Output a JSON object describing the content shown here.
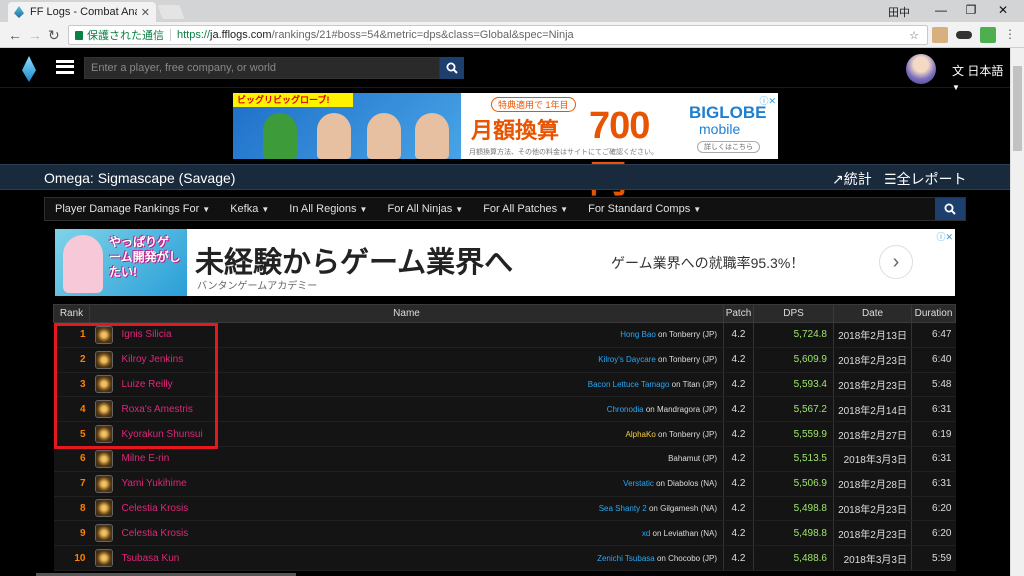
{
  "browser": {
    "tab_title": "FF Logs - Combat Analys",
    "user": "田中",
    "secure_label": "保護された通信",
    "url_scheme": "https://",
    "url_host": "ja.fflogs.com",
    "url_path": "/rankings/21#boss=54&metric=dps&class=Global&spec=Ninja"
  },
  "site": {
    "search_placeholder": "Enter a player, free company, or world",
    "language": "日本語"
  },
  "ad_top": {
    "ribbon": "ビッグリビッグローブ!",
    "tag": "特典適用で 1年目",
    "big_text": "月額換算",
    "price": "700円",
    "fine_print": "月額換算方法、その他の料金はサイトにてご確認ください。",
    "brand1": "BIGLOBE",
    "brand2": "mobile",
    "details": "詳しくはこちら"
  },
  "zone": {
    "title": "Omega: Sigmascape (Savage)",
    "stats": "統計",
    "all_reports": "全レポート"
  },
  "filters": [
    "Player Damage Rankings For",
    "Kefka",
    "In All Regions",
    "For All Ninjas",
    "For All Patches",
    "For Standard Comps"
  ],
  "ad_game": {
    "image_text": "やっぱりゲーム開発がしたい!",
    "headline": "未経験からゲーム業界へ",
    "sub": "バンタンゲームアカデミー",
    "side": "ゲーム業界への就職率95.3%！"
  },
  "table": {
    "headers": [
      "Rank",
      "Name",
      "Patch",
      "DPS",
      "Date",
      "Duration"
    ],
    "rows": [
      {
        "rank": "1",
        "name": "Ignis Silicia",
        "guild": "Hong Bao",
        "server": " on Tonberry (JP)",
        "patch": "4.2",
        "dps": "5,724.8",
        "date": "2018年2月13日",
        "dur": "6:47"
      },
      {
        "rank": "2",
        "name": "Kilroy Jenkins",
        "guild": "Kilroy's Daycare",
        "server": " on Tonberry (JP)",
        "patch": "4.2",
        "dps": "5,609.9",
        "date": "2018年2月23日",
        "dur": "6:40"
      },
      {
        "rank": "3",
        "name": "Luize Reilly",
        "guild": "Bacon Lettuce Tamago",
        "server": " on Titan (JP)",
        "patch": "4.2",
        "dps": "5,593.4",
        "date": "2018年2月23日",
        "dur": "5:48"
      },
      {
        "rank": "4",
        "name": "Roxa's Amestris",
        "guild": "Chronodia",
        "server": " on Mandragora (JP)",
        "patch": "4.2",
        "dps": "5,567.2",
        "date": "2018年2月14日",
        "dur": "6:31"
      },
      {
        "rank": "5",
        "name": "Kyorakun Shunsui",
        "guild": "AlphaKo",
        "server": " on Tonberry (JP)",
        "patch": "4.2",
        "dps": "5,559.9",
        "date": "2018年2月27日",
        "dur": "6:19"
      },
      {
        "rank": "6",
        "name": "Milne E-rin",
        "guild": "",
        "server": "Bahamut (JP)",
        "patch": "4.2",
        "dps": "5,513.5",
        "date": "2018年3月3日",
        "dur": "6:31"
      },
      {
        "rank": "7",
        "name": "Yami Yukihime",
        "guild": "Verstatic",
        "server": " on Diabolos (NA)",
        "patch": "4.2",
        "dps": "5,506.9",
        "date": "2018年2月28日",
        "dur": "6:31"
      },
      {
        "rank": "8",
        "name": "Celestia Krosis",
        "guild": "Sea Shanty 2",
        "server": " on Gilgamesh (NA)",
        "patch": "4.2",
        "dps": "5,498.8",
        "date": "2018年2月23日",
        "dur": "6:20"
      },
      {
        "rank": "9",
        "name": "Celestia Krosis",
        "guild": "xd",
        "server": " on Leviathan (NA)",
        "patch": "4.2",
        "dps": "5,498.8",
        "date": "2018年2月23日",
        "dur": "6:20"
      },
      {
        "rank": "10",
        "name": "Tsubasa Kun",
        "guild": "Zenichi Tsubasa",
        "server": " on Chocobo (JP)",
        "patch": "4.2",
        "dps": "5,488.6",
        "date": "2018年3月3日",
        "dur": "5:59"
      }
    ]
  },
  "colors": {
    "rank": "#ff8000",
    "name": "#e0267a",
    "guild": "#29a8f5",
    "dps": "#9ee86b",
    "highlight": "#e4181e"
  }
}
